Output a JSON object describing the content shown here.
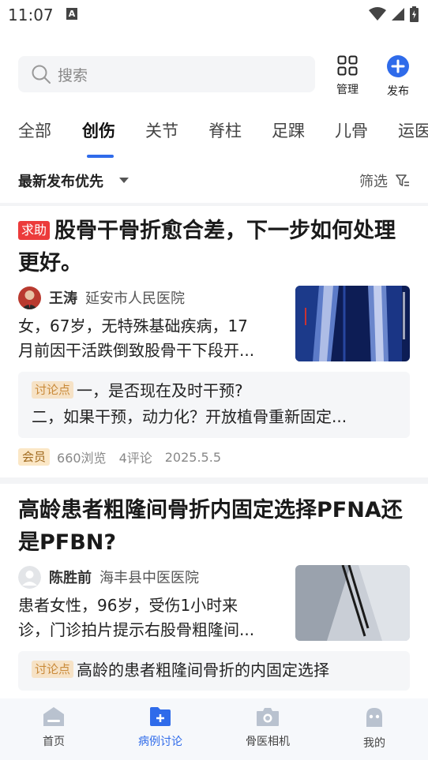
{
  "status": {
    "time": "11:07",
    "notif_glyph": "A"
  },
  "search": {
    "placeholder": "搜索"
  },
  "actions": {
    "manage": "管理",
    "publish": "发布"
  },
  "tabs": [
    "全部",
    "创伤",
    "关节",
    "脊柱",
    "足踝",
    "儿骨",
    "运医"
  ],
  "active_tab": "创伤",
  "sort": {
    "label": "最新发布优先",
    "filter": "筛选"
  },
  "posts": [
    {
      "badge": "求助",
      "title_line1": "股骨干骨折愈合差，下一步如何处理",
      "title_line2": "更好。",
      "author": "王涛",
      "hospital": "延安市人民医院",
      "desc_line1": "女，67岁，无特殊基础疾病，17",
      "desc_line2": "月前因干活跌倒致股骨干下段开...",
      "discuss_badge": "讨论点",
      "discuss_line1": "一，是否现在及时干预?",
      "discuss_line2": "二，如果干预，动力化？开放植骨重新固定...",
      "member_badge": "会员",
      "views": "660浏览",
      "comments": "4评论",
      "date": "2025.5.5"
    },
    {
      "title_line1": "高龄患者粗隆间骨折内固定选择PFNA还",
      "title_line2": "是PFBN?",
      "author": "陈胜前",
      "hospital": "海丰县中医医院",
      "desc_line1": "患者女性，96岁，受伤1小时来",
      "desc_line2": "诊，门诊拍片提示右股骨粗隆间...",
      "discuss_badge": "讨论点",
      "discuss_line1": "高龄的患者粗隆间骨折的内固定选择"
    }
  ],
  "nav": [
    {
      "label": "首页",
      "icon": "home-icon"
    },
    {
      "label": "病例讨论",
      "icon": "case-folder-icon"
    },
    {
      "label": "骨医相机",
      "icon": "camera-icon"
    },
    {
      "label": "我的",
      "icon": "profile-icon"
    }
  ],
  "colors": {
    "accent": "#2f6bea",
    "help_badge": "#ec3b3b",
    "discuss_badge_bg": "#f6e2c6",
    "member_badge_bg": "#fbe7c6"
  }
}
